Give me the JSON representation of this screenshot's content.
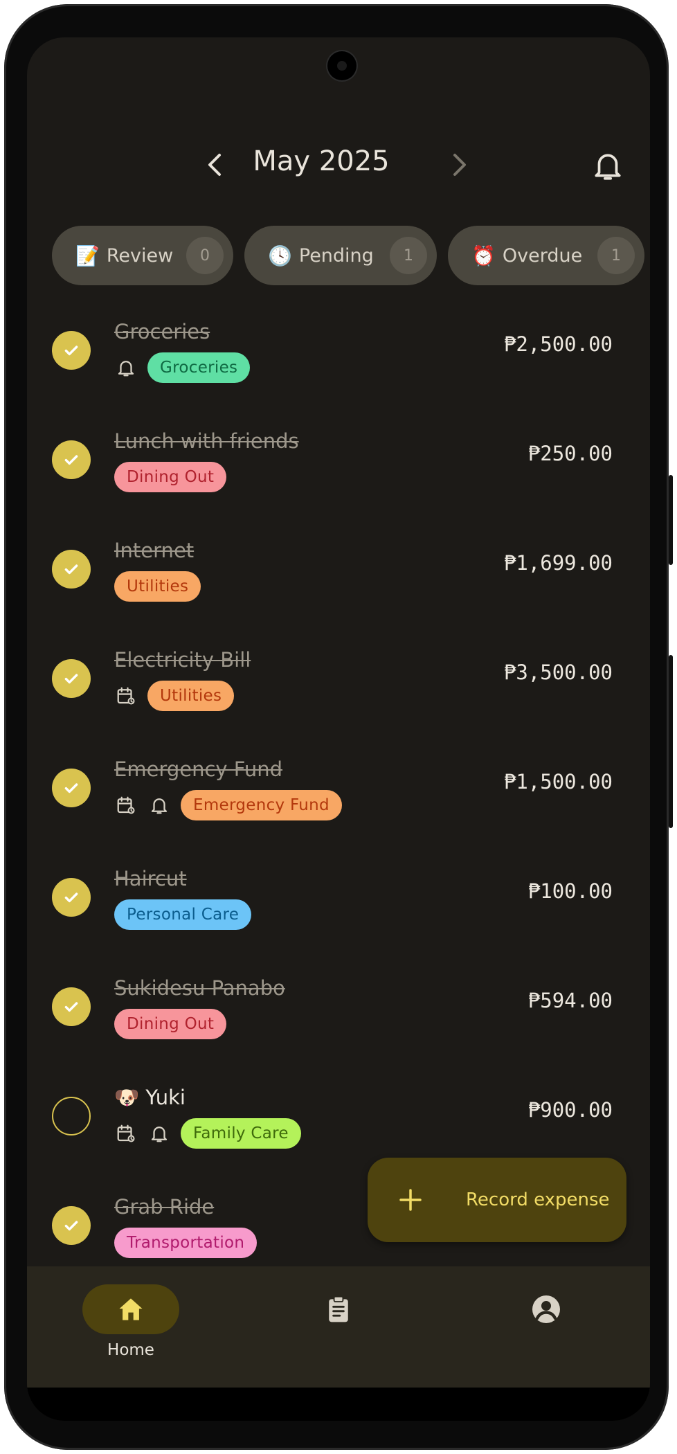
{
  "header": {
    "month": "May 2025"
  },
  "filters": [
    {
      "emoji": "📝",
      "label": "Review",
      "count": "0"
    },
    {
      "emoji": "🕓",
      "label": "Pending",
      "count": "1"
    },
    {
      "emoji": "⏰",
      "label": "Overdue",
      "count": "1"
    }
  ],
  "expenses": [
    {
      "title": "Groceries",
      "done": true,
      "icons": [
        "bell"
      ],
      "tag": "Groceries",
      "amount": "₱2,500.00"
    },
    {
      "title": "Lunch with friends",
      "done": true,
      "icons": [],
      "tag": "Dining Out",
      "amount": "₱250.00"
    },
    {
      "title": "Internet",
      "done": true,
      "icons": [],
      "tag": "Utilities",
      "amount": "₱1,699.00"
    },
    {
      "title": "Electricity Bill",
      "done": true,
      "icons": [
        "calendar-repeat"
      ],
      "tag": "Utilities",
      "amount": "₱3,500.00"
    },
    {
      "title": "Emergency Fund",
      "done": true,
      "icons": [
        "calendar-repeat",
        "bell"
      ],
      "tag": "Emergency Fund",
      "amount": "₱1,500.00"
    },
    {
      "title": "Haircut",
      "done": true,
      "icons": [],
      "tag": "Personal Care",
      "amount": "₱100.00"
    },
    {
      "title": "Sukidesu Panabo",
      "done": true,
      "icons": [],
      "tag": "Dining Out",
      "amount": "₱594.00"
    },
    {
      "title": "🐶 Yuki",
      "done": false,
      "icons": [
        "calendar-repeat",
        "bell"
      ],
      "tag": "Family Care",
      "amount": "₱900.00"
    },
    {
      "title": "Grab Ride",
      "done": true,
      "icons": [],
      "tag": "Transportation",
      "amount": ""
    }
  ],
  "tag_colors": {
    "Groceries": {
      "bg": "#5fdfa4",
      "fg": "#0f6a43"
    },
    "Dining Out": {
      "bg": "#f7959b",
      "fg": "#b0222e"
    },
    "Utilities": {
      "bg": "#f8a764",
      "fg": "#b3380c"
    },
    "Emergency Fund": {
      "bg": "#f8a764",
      "fg": "#b3380c"
    },
    "Personal Care": {
      "bg": "#6cc4f7",
      "fg": "#0b5d8e"
    },
    "Family Care": {
      "bg": "#b4f25a",
      "fg": "#3f6b0b"
    },
    "Transportation": {
      "bg": "#f79bcc",
      "fg": "#b01a6c"
    }
  },
  "fab": {
    "label": "Record expense"
  },
  "nav": [
    {
      "label": "Home",
      "icon": "home-icon",
      "active": true
    },
    {
      "label": "",
      "icon": "clipboard-icon",
      "active": false
    },
    {
      "label": "",
      "icon": "account-icon",
      "active": false
    }
  ],
  "colors": {
    "accent": "#d9c34f",
    "background": "#1c1a17",
    "fab": "#4e430e"
  }
}
